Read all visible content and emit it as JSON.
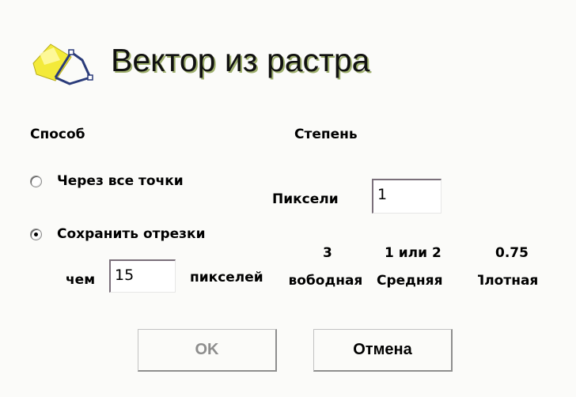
{
  "dialog": {
    "title": "Вектор из растра",
    "logo_icon": "vector-from-raster-icon"
  },
  "method": {
    "label": "Способ",
    "options": [
      {
        "label": "Через все точки",
        "selected": false
      },
      {
        "label": "Сохранить отрезки",
        "selected": true
      }
    ],
    "segment_prefix": "чем",
    "segment_value": "15",
    "segment_suffix": "пикселей"
  },
  "degree": {
    "label": "Степень",
    "pixels_label": "Пиксели",
    "pixels_value": "1",
    "presets": [
      {
        "value": "3",
        "name": "Свободная"
      },
      {
        "value": "1 или 2",
        "name": "Средняя"
      },
      {
        "value": "0.75",
        "name": "Плотная"
      }
    ]
  },
  "buttons": {
    "ok": "OK",
    "cancel": "Отмена"
  },
  "colors": {
    "title_shadow": "#9fb06e",
    "logo_yellow": "#f3ea3a",
    "logo_outline": "#2a3b7a",
    "disabled_text": "#8d8d8d"
  }
}
